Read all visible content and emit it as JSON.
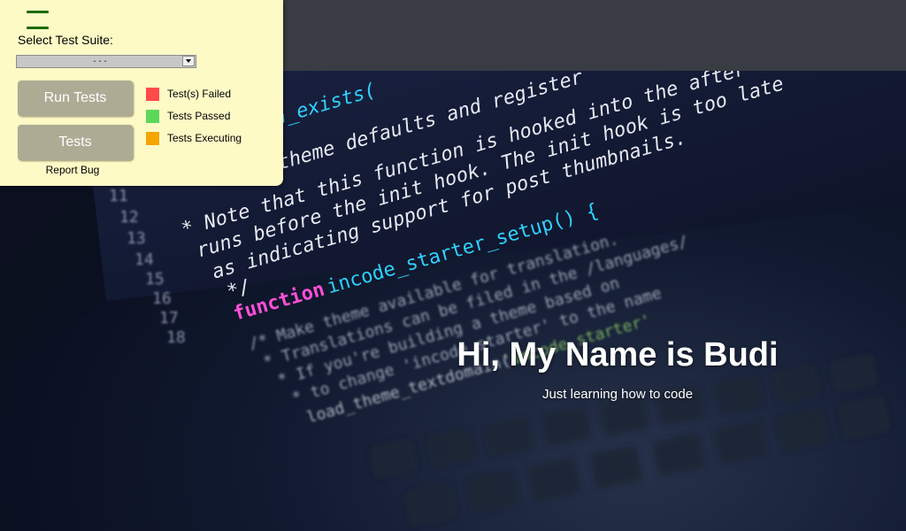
{
  "panel": {
    "menu_icon": "hamburger-menu-icon",
    "suite_label": "Select Test Suite:",
    "suite_select": {
      "selected": "- - -"
    },
    "run_tests_label": "Run Tests",
    "tests_label": "Tests",
    "report_bug_label": "Report Bug",
    "legend": [
      {
        "label": "Test(s) Failed",
        "color": "#ff4a4a"
      },
      {
        "label": "Tests Passed",
        "color": "#5bd85b"
      },
      {
        "label": "Tests Executing",
        "color": "#f5a500"
      }
    ]
  },
  "hero": {
    "title": "Hi, My Name is Budi",
    "subtitle": "Just learning how to code"
  }
}
